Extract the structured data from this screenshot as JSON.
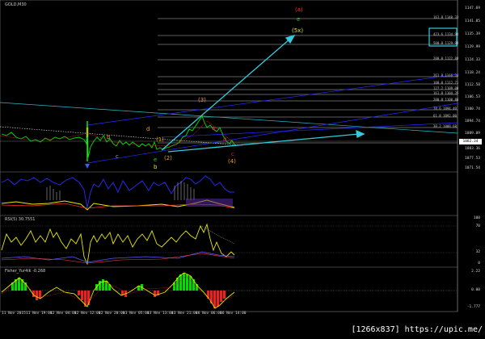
{
  "panes": {
    "main_title": "GOLD,M30",
    "rsi_title": "RSI(5) 30.7551",
    "fisher_title": "Fisher_Yur4ik -0.268"
  },
  "price_axis": [
    "1147.69",
    "1141.05",
    "1135.39",
    "1129.99",
    "1124.33",
    "1118.24",
    "1112.50",
    "1106.53",
    "1100.74",
    "1094.74",
    "1089.09",
    "1083.36",
    "1077.53",
    "1071.54"
  ],
  "current_price": "1082.34",
  "rsi_axis": [
    "100",
    "70",
    "32",
    "0"
  ],
  "fisher_axis": [
    "2.22",
    "0.00",
    "-1.777"
  ],
  "time_axis": [
    "11 Nov 2015",
    "11 Nov 19:00",
    "12 Nov 04:00",
    "12 Nov 12:00",
    "12 Nov 20:00",
    "13 Nov 05:00",
    "13 Nov 13:00",
    "13 Nov 21:00",
    "16 Nov 06:00",
    "16 Nov 14:00"
  ],
  "fib_levels": [
    "161.8 1140.33",
    "423.6 1134.94",
    "500.0 1129.98",
    "200.0 1122.88",
    "261.8 1116.34",
    "100.0 1112.71",
    "127.2 1109.08",
    "161.8 1104.35",
    "200.0 1100.86",
    "78.6 1094.40",
    "61.8 1092.00",
    "38.2 1088.68"
  ],
  "waves": {
    "a_top": "(a)",
    "e_top": "e",
    "w5": "(5x)",
    "w3": "(3)",
    "w2": "(2)",
    "w4": "(4)",
    "w1": "(1)",
    "e_low": "e",
    "b_low": "b",
    "d_mid": "d",
    "c_mid": "c",
    "b_mid": "b",
    "c_small": "c",
    "a_small": "a",
    "d_small": "d"
  },
  "colors": {
    "background": "#000000",
    "up_candle": "#00ff00",
    "down_candle": "#ff0000",
    "wave_orange": "#e8a317",
    "wave_yellow": "#e8e800",
    "wave_red": "#ff2a2a",
    "arrow_cyan": "#33ccdd",
    "fib_line": "#bdbdbd",
    "channel_blue": "#2a2aff"
  },
  "watermark": "[1266x837] https://upic.me/"
}
